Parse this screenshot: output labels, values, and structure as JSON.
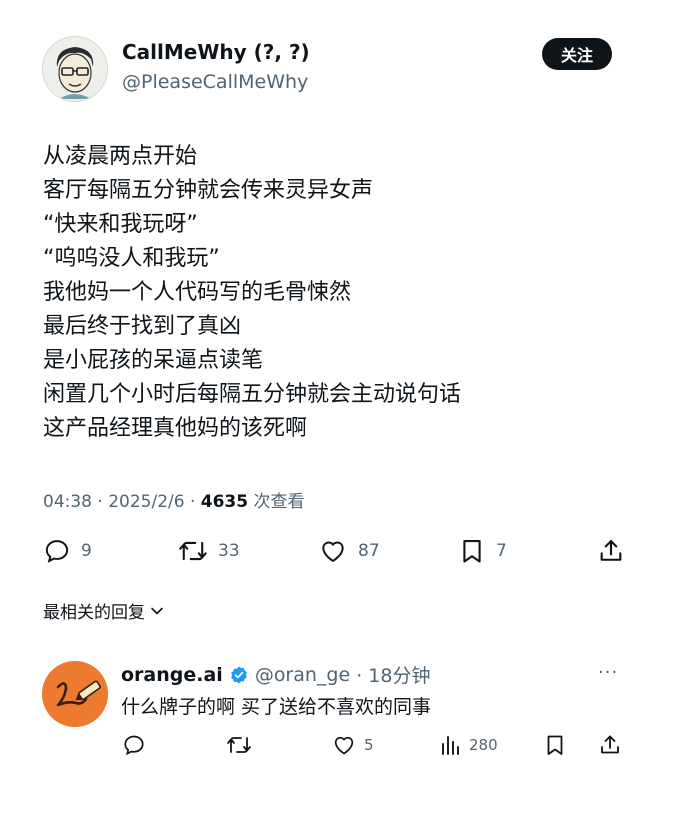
{
  "post": {
    "author": {
      "name": "CallMeWhy (?, ?)",
      "handle": "@PleaseCallMeWhy"
    },
    "follow_label": "关注",
    "lines": [
      "从凌晨两点开始",
      "客厅每隔五分钟就会传来灵异女声",
      "“快来和我玩呀”",
      "“呜呜没人和我玩”",
      "我他妈一个人代码写的毛骨悚然",
      "最后终于找到了真凶",
      "是小屁孩的呆逼点读笔",
      "闲置几个小时后每隔五分钟就会主动说句话",
      "这产品经理真他妈的该死啊"
    ],
    "time": "04:38 · 2025/2/6 · ",
    "views": "4635",
    "views_suffix": " 次查看",
    "actions": {
      "replies": "9",
      "reposts": "33",
      "likes": "87",
      "bookmarks": "7"
    }
  },
  "relevant_replies_label": "最相关的回复",
  "reply": {
    "name": "orange.ai",
    "handle": "@oran_ge",
    "time": "· 18分钟",
    "text": "什么牌子的啊 买了送给不喜欢的同事",
    "more": "···",
    "actions": {
      "likes": "5",
      "views": "280"
    }
  },
  "colors": {
    "text": "#0f1419",
    "muted": "#536471",
    "verified": "#1d9bf0",
    "avatar_orange": "#ee7a2f"
  }
}
